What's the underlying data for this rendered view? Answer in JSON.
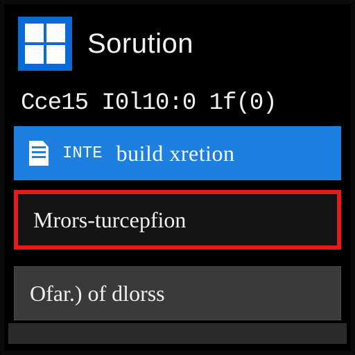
{
  "header": {
    "title": "Sorution",
    "icon": "windows-icon"
  },
  "status_line": "Cce15 I0l10:0 1f(0)",
  "items": {
    "build": {
      "keyword": "INTE",
      "label": "build xretion"
    },
    "errors": {
      "label": "Mrors-turcepfion"
    },
    "other": {
      "label": "Ofar.) of dlorss"
    }
  },
  "colors": {
    "accent": "#1d7fe0",
    "error": "#e41b1b",
    "highlight": "#f5dc1e"
  }
}
